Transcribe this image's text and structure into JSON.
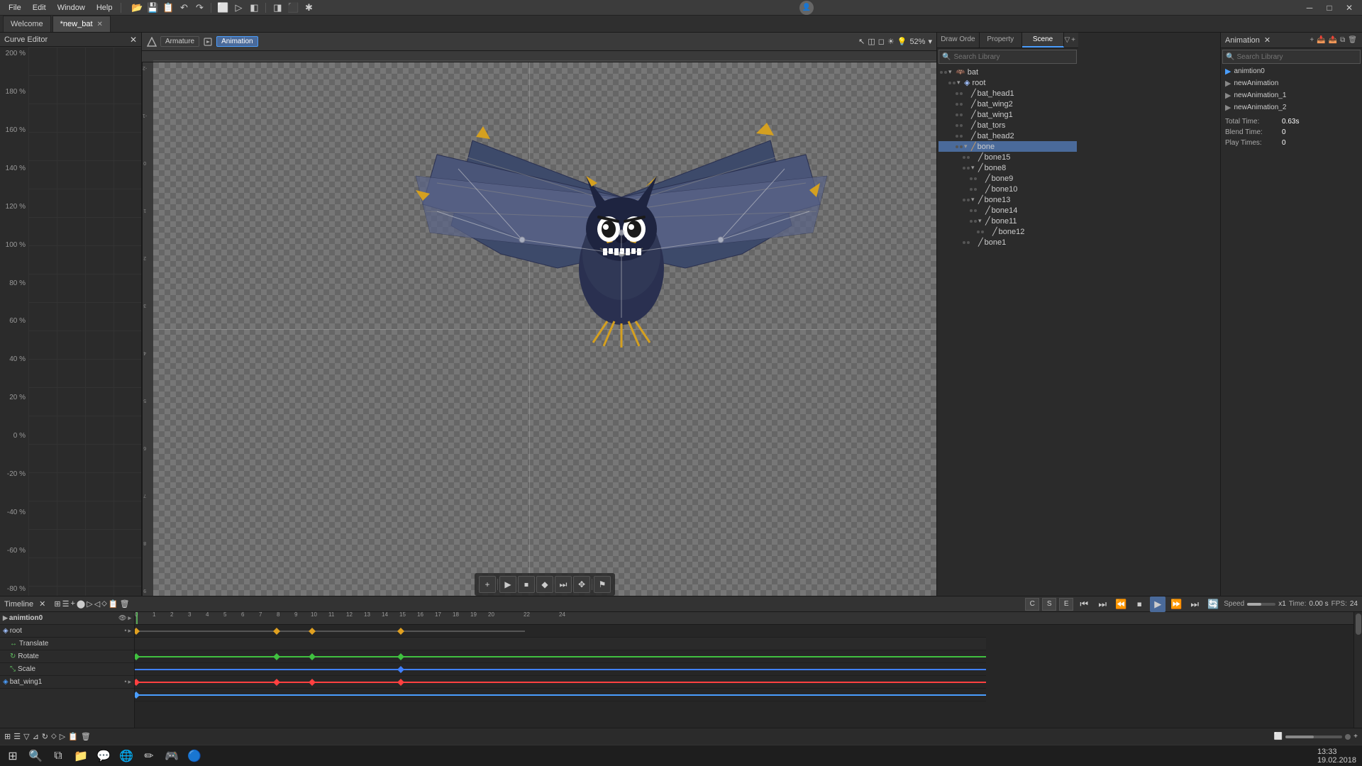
{
  "app": {
    "title": "Curve Editor"
  },
  "menu": {
    "items": [
      "File",
      "Edit",
      "Window",
      "Help"
    ]
  },
  "tabs": [
    {
      "label": "Welcome",
      "closable": false,
      "active": false
    },
    {
      "label": "*new_bat",
      "closable": true,
      "active": true
    }
  ],
  "right_panel_tabs": [
    {
      "label": "Draw Orde",
      "active": false
    },
    {
      "label": "Property",
      "active": false
    },
    {
      "label": "Scene",
      "active": true
    }
  ],
  "viewport": {
    "zoom": "52%",
    "mode_armature": "Armature",
    "mode_animation": "Animation"
  },
  "scene_tree": {
    "search_placeholder": "Search Library",
    "items": [
      {
        "indent": 0,
        "label": "bat",
        "has_children": true,
        "expanded": true,
        "icon": "folder"
      },
      {
        "indent": 1,
        "label": "root",
        "has_children": true,
        "expanded": true,
        "icon": "folder"
      },
      {
        "indent": 2,
        "label": "bat_head1",
        "has_children": false,
        "icon": "bone"
      },
      {
        "indent": 2,
        "label": "bat_wing2",
        "has_children": false,
        "icon": "bone"
      },
      {
        "indent": 2,
        "label": "bat_wing1",
        "has_children": false,
        "icon": "bone"
      },
      {
        "indent": 2,
        "label": "bat_tors",
        "has_children": false,
        "icon": "bone"
      },
      {
        "indent": 2,
        "label": "bat_head2",
        "has_children": false,
        "icon": "bone"
      },
      {
        "indent": 2,
        "label": "bone",
        "has_children": true,
        "expanded": true,
        "icon": "bone",
        "selected": true
      },
      {
        "indent": 3,
        "label": "bone15",
        "has_children": false,
        "icon": "bone"
      },
      {
        "indent": 3,
        "label": "bone8",
        "has_children": true,
        "expanded": true,
        "icon": "bone"
      },
      {
        "indent": 4,
        "label": "bone9",
        "has_children": false,
        "icon": "bone"
      },
      {
        "indent": 4,
        "label": "bone10",
        "has_children": false,
        "icon": "bone"
      },
      {
        "indent": 3,
        "label": "bone13",
        "has_children": true,
        "expanded": true,
        "icon": "bone"
      },
      {
        "indent": 4,
        "label": "bone14",
        "has_children": false,
        "icon": "bone"
      },
      {
        "indent": 4,
        "label": "bone11",
        "has_children": true,
        "expanded": true,
        "icon": "bone"
      },
      {
        "indent": 5,
        "label": "bone12",
        "has_children": false,
        "icon": "bone"
      },
      {
        "indent": 3,
        "label": "bone1",
        "has_children": false,
        "icon": "bone"
      }
    ]
  },
  "curve_scale": {
    "values": [
      "200 %",
      "180 %",
      "160 %",
      "140 %",
      "120 %",
      "100 %",
      "80 %",
      "60 %",
      "40 %",
      "20 %",
      "0 %",
      "-20 %",
      "-40 %",
      "-60 %",
      "-80 %"
    ]
  },
  "timeline": {
    "label": "Timeline",
    "fps": "24",
    "speed": "Speed",
    "time": "0.00 s",
    "multiplier": "x1",
    "tracks": [
      {
        "name": "animtion0",
        "type": "animation",
        "indent": 0
      },
      {
        "name": "root",
        "type": "object",
        "indent": 0
      },
      {
        "name": "Translate",
        "type": "translate",
        "indent": 1
      },
      {
        "name": "Rotate",
        "type": "rotate",
        "indent": 1
      },
      {
        "name": "Scale",
        "type": "scale",
        "indent": 1
      },
      {
        "name": "bat_wing1",
        "type": "object",
        "indent": 0
      }
    ]
  },
  "animation_panel": {
    "title": "Animation",
    "search_placeholder": "Search Library",
    "search_icon": "🔍",
    "items": [
      {
        "label": "animtion0",
        "active": true
      },
      {
        "label": "newAnimation",
        "active": false
      },
      {
        "label": "newAnimation_1",
        "active": false
      },
      {
        "label": "newAnimation_2",
        "active": false
      }
    ],
    "total_time_label": "Total Time:",
    "total_time_value": "0.63s",
    "blend_time_label": "Blend Time:",
    "blend_time_value": "0",
    "play_times_label": "Play Times:",
    "play_times_value": "0"
  },
  "playback": {
    "buttons": [
      "⏮",
      "⏭",
      "⏪",
      "⏹",
      "▶",
      "⏩",
      "⏭"
    ]
  },
  "taskbar": {
    "time": "13:33",
    "date": "19.02.2018",
    "icons": [
      "⊞",
      "🔍",
      "□",
      "📁",
      "💬",
      "🌐",
      "✏",
      "🎮",
      "🔒"
    ]
  },
  "toolbar": {
    "undo": "↶",
    "redo": "↷",
    "icons": [
      "📁",
      "💾",
      "⏮",
      "↶",
      "↷",
      "⬜",
      "▷",
      "◧",
      "◨",
      "⬛",
      "✱"
    ]
  }
}
